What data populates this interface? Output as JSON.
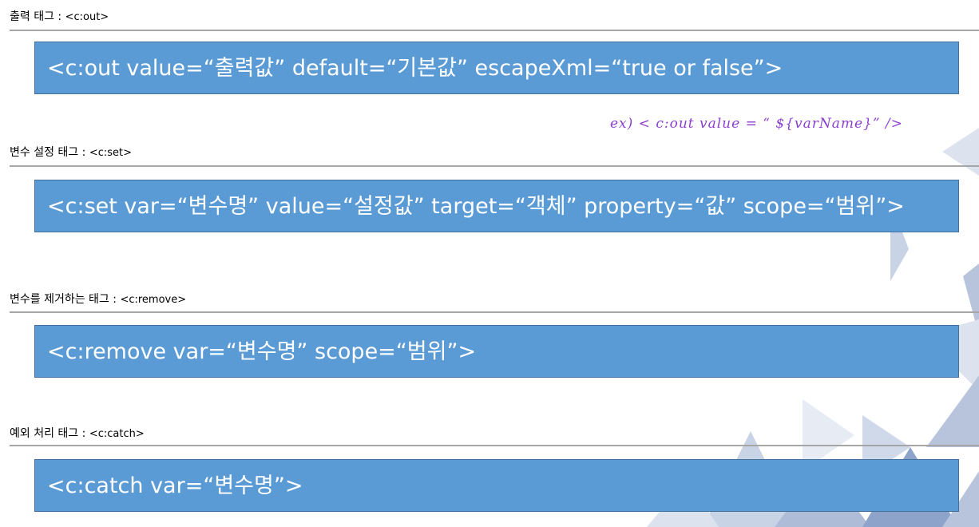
{
  "sections": [
    {
      "title": "출력 태그 : ",
      "tag": "<c:out>",
      "code": "<c:out value=“출력값” default=“기본값” escapeXml=“true or false”>"
    },
    {
      "title": "변수 설정 태그 : ",
      "tag": "<c:set>",
      "code": "<c:set var=“변수명” value=“설정값” target=“객체” property=“값” scope=“범위”>"
    },
    {
      "title": "변수를 제거하는 태그 : ",
      "tag": "<c:remove>",
      "code": "<c:remove var=“변수명” scope=“범위”>"
    },
    {
      "title": "예외 처리 태그 : ",
      "tag": "<c:catch>",
      "code": "<c:catch var=“변수명”>"
    }
  ],
  "handwritten_note": "ex) < c:out value = “ ${varName}” />",
  "colors": {
    "box_fill": "#5b9bd5",
    "box_border": "#41719c",
    "box_text": "#ffffff",
    "rule": "#a6a6a6",
    "note_ink": "#8a3fd1",
    "triangle_light": "#dde3ee",
    "triangle_mid": "#b8c4dc",
    "triangle_dark": "#8ea3c9"
  }
}
